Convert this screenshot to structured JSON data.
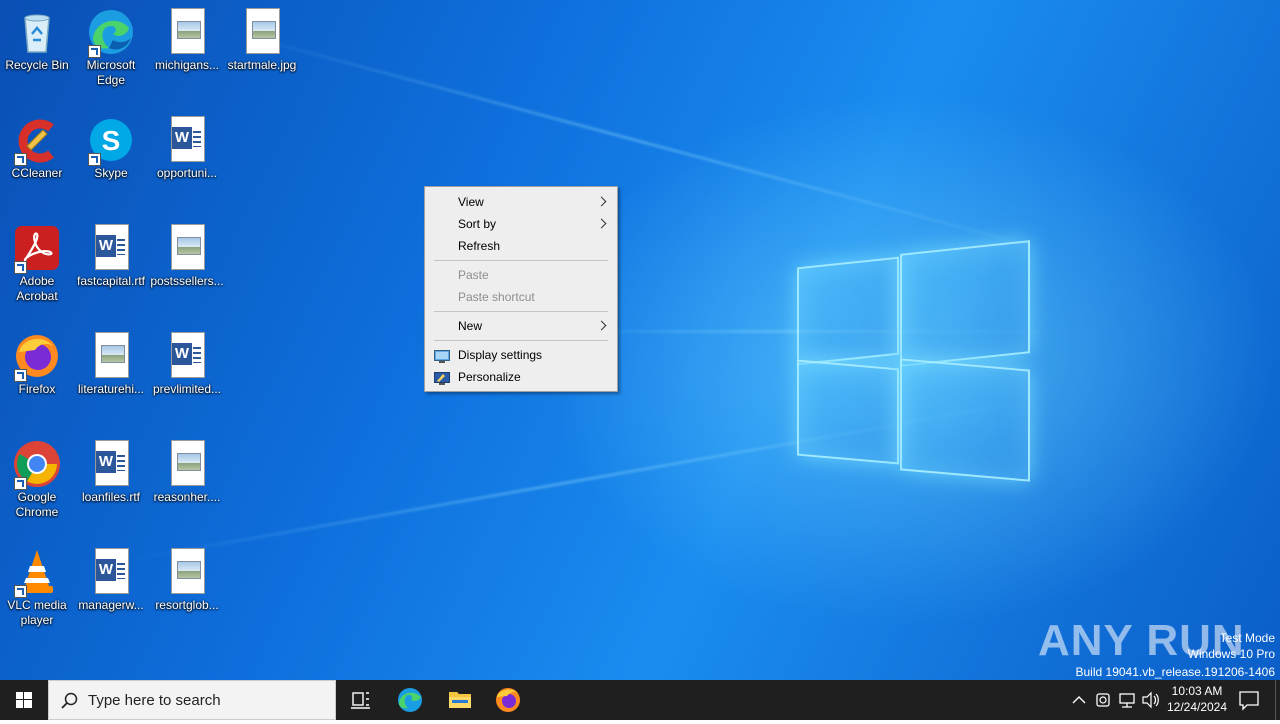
{
  "desktop": {
    "icons": [
      {
        "label": "Recycle Bin",
        "icon": "recycle-bin-icon"
      },
      {
        "label": "Microsoft Edge",
        "icon": "edge-icon"
      },
      {
        "label": "michigans...",
        "icon": "image-file-icon"
      },
      {
        "label": "startmale.jpg",
        "icon": "image-file-icon"
      },
      {
        "label": "CCleaner",
        "icon": "ccleaner-icon"
      },
      {
        "label": "Skype",
        "icon": "skype-icon"
      },
      {
        "label": "opportuni...",
        "icon": "word-document-icon"
      },
      {
        "label": "Adobe Acrobat",
        "icon": "acrobat-icon"
      },
      {
        "label": "fastcapital.rtf",
        "icon": "word-document-icon"
      },
      {
        "label": "postssellers...",
        "icon": "image-file-icon"
      },
      {
        "label": "Firefox",
        "icon": "firefox-icon"
      },
      {
        "label": "literaturehi...",
        "icon": "image-file-icon"
      },
      {
        "label": "prevlimited...",
        "icon": "word-document-icon"
      },
      {
        "label": "Google Chrome",
        "icon": "chrome-icon"
      },
      {
        "label": "loanfiles.rtf",
        "icon": "word-document-icon"
      },
      {
        "label": "reasonher....",
        "icon": "image-file-icon"
      },
      {
        "label": "VLC media player",
        "icon": "vlc-icon"
      },
      {
        "label": "managerw...",
        "icon": "word-document-icon"
      },
      {
        "label": "resortglob...",
        "icon": "image-file-icon"
      }
    ]
  },
  "context_menu": {
    "view": "View",
    "sort_by": "Sort by",
    "refresh": "Refresh",
    "paste": "Paste",
    "paste_shortcut": "Paste shortcut",
    "new": "New",
    "display_settings": "Display settings",
    "personalize": "Personalize"
  },
  "watermark": {
    "brand": "ANY RUN",
    "test_mode": "Test Mode",
    "edition": "Windows 10 Pro",
    "build": "Build 19041.vb_release.191206-1406"
  },
  "taskbar": {
    "search_placeholder": "Type here to search",
    "time": "10:03 AM",
    "date": "12/24/2024"
  },
  "colors": {
    "taskbar_bg": "#1f1f1f",
    "menu_bg": "#eeeeee",
    "desktop_accent": "#0e6fdc"
  }
}
